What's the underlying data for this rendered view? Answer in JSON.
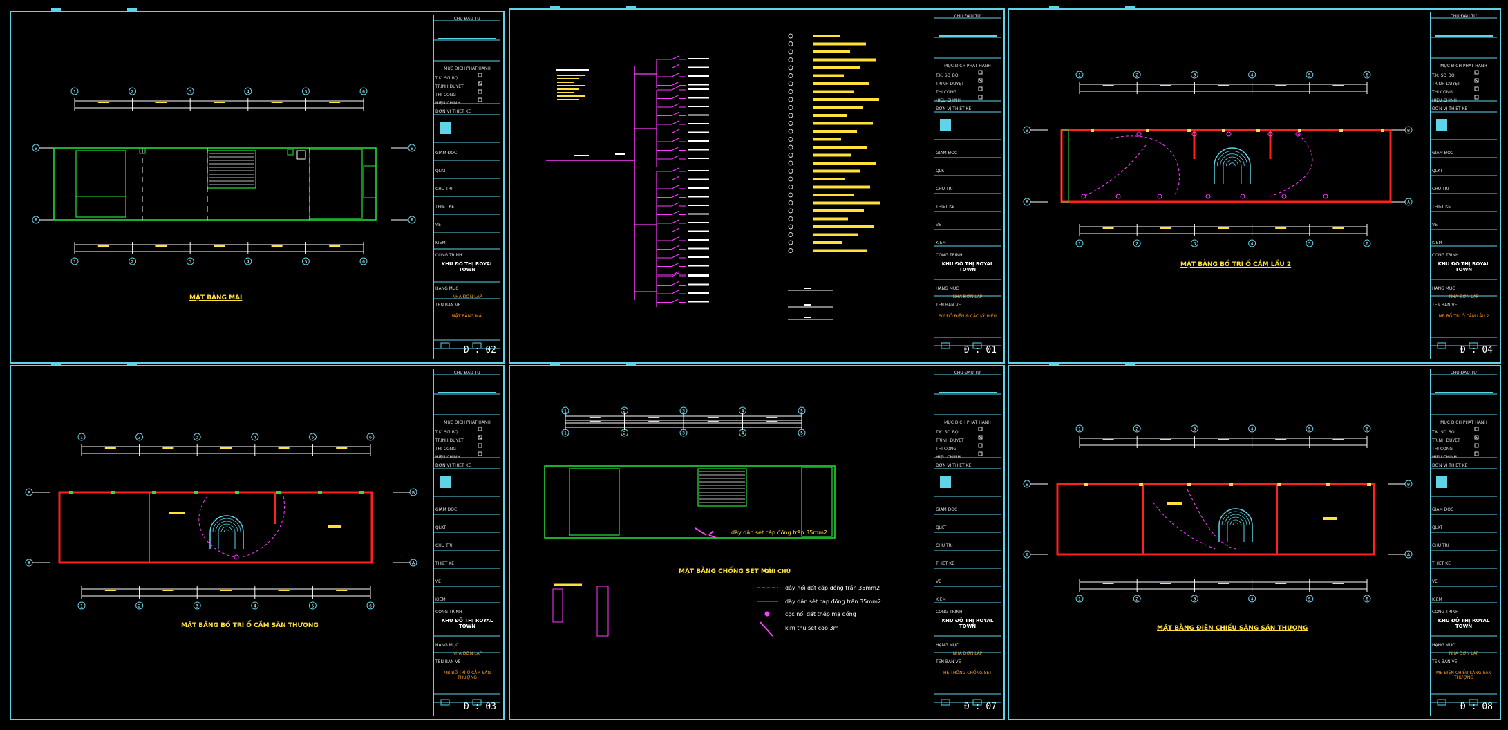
{
  "title_block": {
    "owner": "CHỦ ĐẦU TƯ",
    "purpose": "MỤC ĐÍCH PHÁT HÀNH",
    "options": [
      "T.K. SƠ BỘ",
      "TRÌNH DUYỆT",
      "THI CÔNG",
      "HIỆU CHỈNH"
    ],
    "designer": "ĐƠN VỊ THIẾT KẾ",
    "roles": [
      "GIÁM ĐỐC",
      "QLKT",
      "CHỦ TRÌ",
      "THIẾT KẾ",
      "VẼ",
      "KIỂM"
    ],
    "project_label": "CÔNG TRÌNH",
    "project": "KHU ĐÔ THỊ ROYAL TOWN",
    "item_label": "HẠNG MỤC",
    "item": "NHÀ ĐƠN LẬP",
    "drawing_label": "TÊN BẢN VẼ"
  },
  "sheets": [
    {
      "no": "Đ : 02",
      "drawing": "MẶT BẰNG MÁI",
      "caption": "MẶT BẰNG MÁI"
    },
    {
      "no": "Đ : 01",
      "drawing": "SƠ ĐỒ ĐIỆN & CÁC KÝ HIỆU",
      "caption": ""
    },
    {
      "no": "Đ : 04",
      "drawing": "MB BỐ TRÍ Ổ CẮM LẦU 2",
      "caption": "MẶT BẰNG BỐ TRÍ Ổ CẮM LẦU 2"
    },
    {
      "no": "Đ : 03",
      "drawing": "MB BỐ TRÍ Ổ CẮM SÂN THƯỢNG",
      "caption": "MẶT BẰNG BỐ TRÍ Ổ CẮM SÂN THƯỢNG"
    },
    {
      "no": "Đ : 07",
      "drawing": "HỆ THỐNG CHỐNG SÉT",
      "caption": "MẶT BẰNG CHỐNG SÉT MÁI"
    },
    {
      "no": "Đ : 08",
      "drawing": "MB ĐIỆN CHIẾU SÁNG SÂN THƯỢNG",
      "caption": "MẶT BẰNG ĐIỆN CHIẾU SÁNG SÂN THƯỢNG"
    }
  ],
  "grid_labels": [
    "1",
    "2",
    "3",
    "4",
    "5",
    "6"
  ],
  "row_labels": [
    "A",
    "B"
  ],
  "lightning": {
    "legend_title": "GHI CHÚ",
    "items": [
      "dây nối đất cáp đồng trần 35mm2",
      "dây dẫn sét cáp đồng trần 35mm2",
      "cọc nối đất thép mạ đồng",
      "kim thu sét cao 3m"
    ],
    "note": "dây dẫn sét cáp đồng trần 35mm2"
  },
  "colors": {
    "frame": "#5fd3e8",
    "wall": "#ff2020",
    "outline": "#27e43a",
    "wiring": "#ff3cff",
    "text": "#ffe13a"
  }
}
